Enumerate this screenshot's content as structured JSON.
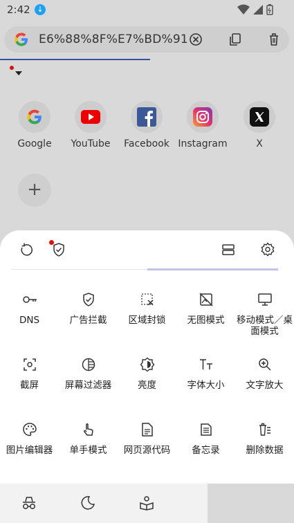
{
  "status_bar": {
    "time": "2:42"
  },
  "url_bar": {
    "url_text": "E6%88%8F%E7%BD%91"
  },
  "shortcuts": [
    {
      "label": "Google",
      "icon": "google-icon"
    },
    {
      "label": "YouTube",
      "icon": "youtube-icon"
    },
    {
      "label": "Facebook",
      "icon": "facebook-icon"
    },
    {
      "label": "Instagram",
      "icon": "instagram-icon"
    },
    {
      "label": "X",
      "icon": "x-icon"
    }
  ],
  "menu": {
    "items": [
      {
        "label": "DNS",
        "icon": "key-icon"
      },
      {
        "label": "广告拦截",
        "icon": "shield-check-icon"
      },
      {
        "label": "区域封锁",
        "icon": "region-block-icon"
      },
      {
        "label": "无图模式",
        "icon": "no-image-icon"
      },
      {
        "label": "移动模式／桌面模式",
        "icon": "desktop-icon"
      },
      {
        "label": "截屏",
        "icon": "screenshot-icon"
      },
      {
        "label": "屏幕过滤器",
        "icon": "screen-filter-icon"
      },
      {
        "label": "亮度",
        "icon": "brightness-icon"
      },
      {
        "label": "字体大小",
        "icon": "font-size-icon"
      },
      {
        "label": "文字放大",
        "icon": "zoom-in-icon"
      },
      {
        "label": "图片编辑器",
        "icon": "palette-icon"
      },
      {
        "label": "单手模式",
        "icon": "one-hand-icon"
      },
      {
        "label": "网页源代码",
        "icon": "page-source-icon"
      },
      {
        "label": "备忘录",
        "icon": "memo-icon"
      },
      {
        "label": "删除数据",
        "icon": "delete-data-icon"
      }
    ]
  },
  "colors": {
    "accent": "#3a4fa0",
    "red_dot": "#e01010",
    "indicator": "#c0c4e6"
  }
}
